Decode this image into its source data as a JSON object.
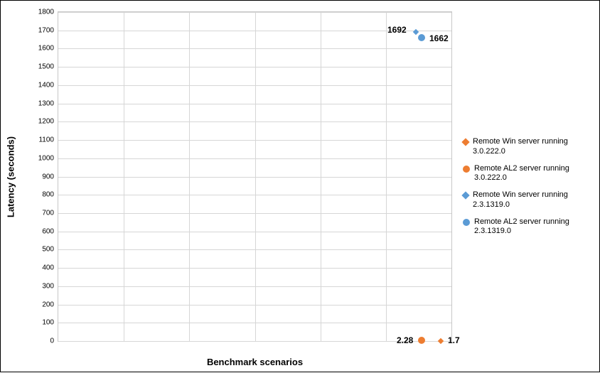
{
  "chart_data": {
    "type": "scatter",
    "title": "",
    "xlabel": "Benchmark scenarios",
    "ylabel": "Latency (seconds)",
    "ylim": [
      0,
      1800
    ],
    "y_ticks": [
      0,
      100,
      200,
      300,
      400,
      500,
      600,
      700,
      800,
      900,
      1000,
      1100,
      1200,
      1300,
      1400,
      1500,
      1600,
      1700,
      1800
    ],
    "x_categories_count": 6,
    "series": [
      {
        "name": "Remote Win server running 3.0.222.0",
        "marker": {
          "shape": "diamond",
          "color": "#ed7d31"
        },
        "points": [
          {
            "category": 6,
            "value": 1.7,
            "data_label": "1.7"
          }
        ]
      },
      {
        "name": "Remote AL2 server running 3.0.222.0",
        "marker": {
          "shape": "circle",
          "color": "#ed7d31"
        },
        "points": [
          {
            "category": 5.55,
            "value": 2.28,
            "data_label": "2.28"
          }
        ]
      },
      {
        "name": "Remote Win server running 2.3.1319.0",
        "marker": {
          "shape": "diamond",
          "color": "#5b9bd5"
        },
        "points": [
          {
            "category": 5.45,
            "value": 1692,
            "data_label": "1692"
          }
        ]
      },
      {
        "name": "Remote AL2 server running 2.3.1319.0",
        "marker": {
          "shape": "circle",
          "color": "#5b9bd5"
        },
        "points": [
          {
            "category": 5.55,
            "value": 1662,
            "data_label": "1662"
          }
        ]
      }
    ]
  },
  "colors": {
    "orange": "#ed7d31",
    "blue": "#5b9bd5"
  }
}
